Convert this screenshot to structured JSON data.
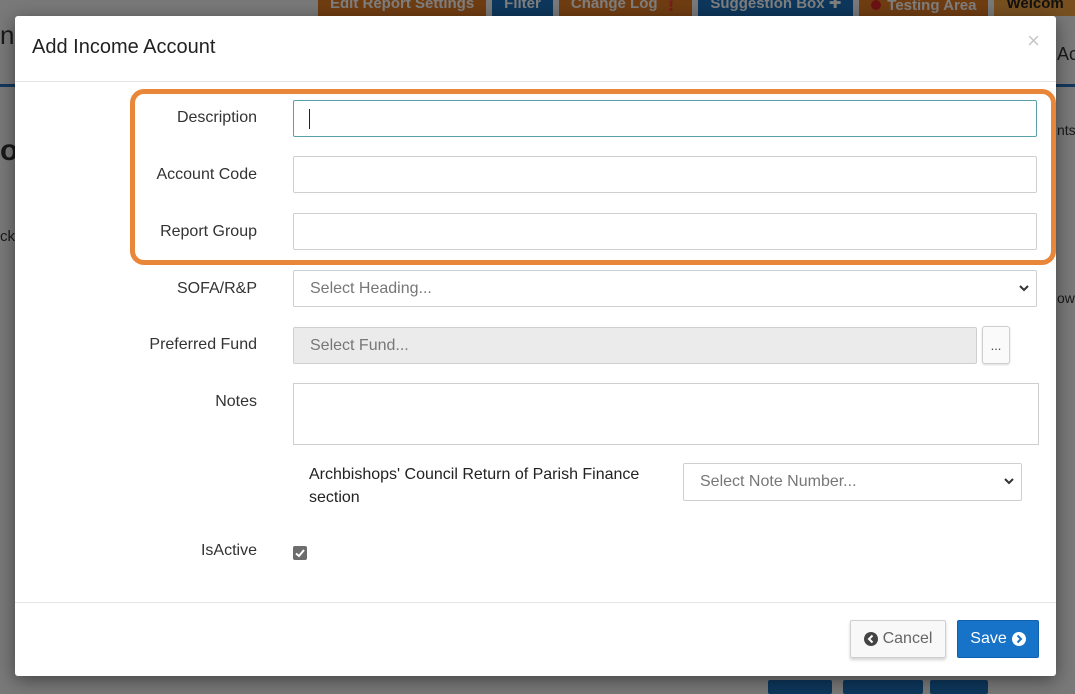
{
  "background": {
    "nav_tabs": [
      {
        "label": "Edit Report Settings",
        "style": "orange"
      },
      {
        "label": "Filter",
        "style": "blue"
      },
      {
        "label": "Change Log ❗",
        "style": "orange"
      },
      {
        "label": "Suggestion Box ✚",
        "style": "blue"
      },
      {
        "label": "Testing Area",
        "style": "orange-dot"
      },
      {
        "label": "Welcom",
        "style": "welcome"
      }
    ],
    "fragments": [
      "n",
      "Ac",
      "or",
      "ck",
      "nts",
      "ow"
    ]
  },
  "modal": {
    "title": "Add Income Account",
    "close_symbol": "×",
    "fields": {
      "description": {
        "label": "Description",
        "value": ""
      },
      "account_code": {
        "label": "Account Code",
        "value": ""
      },
      "report_group": {
        "label": "Report Group",
        "value": ""
      },
      "sofa": {
        "label": "SOFA/R&P",
        "placeholder": "Select Heading..."
      },
      "preferred_fund": {
        "label": "Preferred Fund",
        "placeholder": "Select Fund...",
        "button_label": "..."
      },
      "notes": {
        "label": "Notes",
        "value": ""
      },
      "archbishops": {
        "label": "Archbishops' Council Return of Parish Finance section",
        "placeholder": "Select Note Number..."
      },
      "is_active": {
        "label": "IsActive",
        "checked": true
      }
    },
    "buttons": {
      "cancel": "Cancel",
      "save": "Save"
    }
  },
  "colors": {
    "highlight": "#e8863a",
    "primary": "#1673c8",
    "focus_border": "#5aa0a8"
  }
}
